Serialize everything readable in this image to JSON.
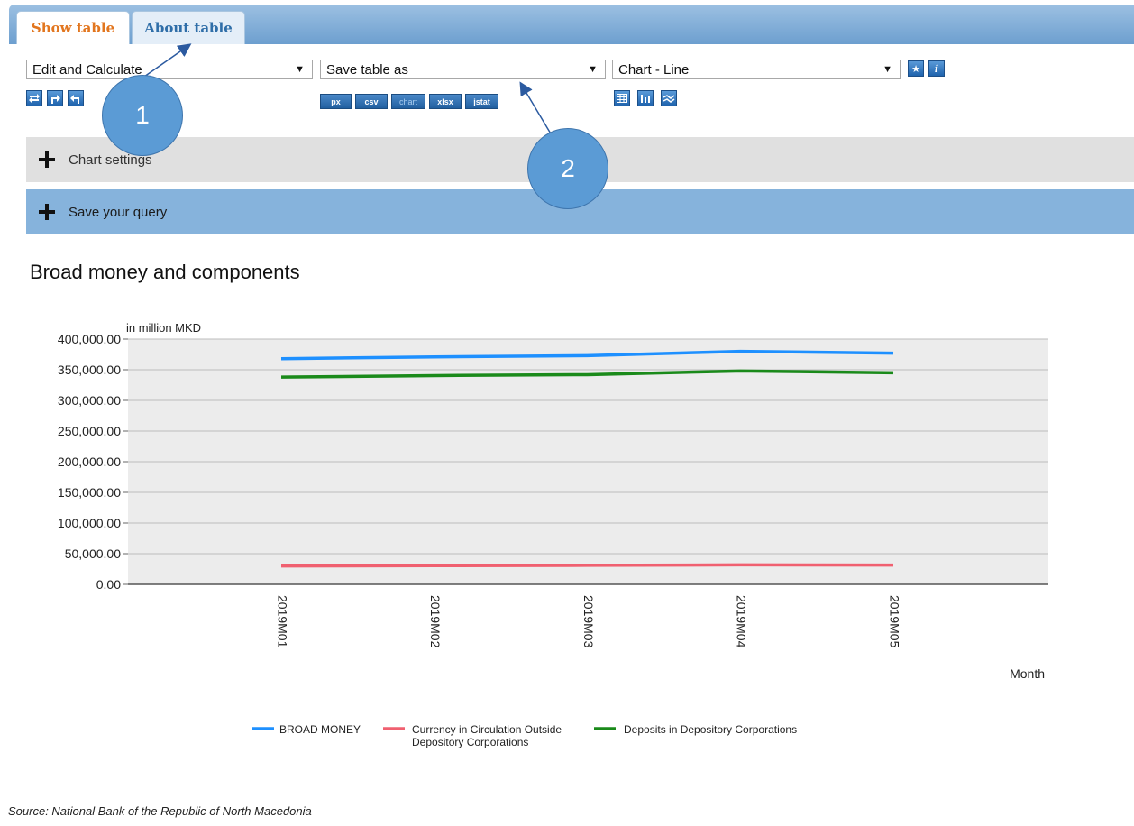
{
  "tabs": [
    {
      "label": "Show table",
      "active": true
    },
    {
      "label": "About table",
      "active": false
    }
  ],
  "toolbar": {
    "select1": "Edit and Calculate",
    "select2": "Save table as",
    "select3": "Chart - Line",
    "format_buttons": [
      "px",
      "csv",
      "chart",
      "xlsx",
      "jstat"
    ],
    "info_label": "i"
  },
  "accordions": {
    "chart_settings": "Chart settings",
    "save_query": "Save your query"
  },
  "annotations": [
    "1",
    "2"
  ],
  "source": "Source: National Bank of the Republic of North Macedonia",
  "colors": {
    "broad_money": "#1e90ff",
    "currency": "#f06070",
    "deposits": "#1a8a1a",
    "tab_active": "#e2761f",
    "accent": "#86b3dc"
  },
  "chart_data": {
    "type": "line",
    "title": "Broad money and components",
    "ylabel": "in million MKD",
    "xlabel": "Month",
    "ylim": [
      0,
      400000
    ],
    "yticks": [
      "0.00",
      "50,000.00",
      "100,000.00",
      "150,000.00",
      "200,000.00",
      "250,000.00",
      "300,000.00",
      "350,000.00",
      "400,000.00"
    ],
    "categories": [
      "2019M01",
      "2019M02",
      "2019M03",
      "2019M04",
      "2019M05"
    ],
    "legend_position": "bottom",
    "series": [
      {
        "name": "BROAD MONEY",
        "color": "#1e90ff",
        "values": [
          368000,
          371000,
          373000,
          380000,
          377000
        ]
      },
      {
        "name": "Currency in Circulation Outside Depository Corporations",
        "color": "#f06070",
        "values": [
          30000,
          30500,
          31000,
          31800,
          31500
        ]
      },
      {
        "name": "Deposits in Depository Corporations",
        "color": "#1a8a1a",
        "values": [
          338000,
          340500,
          342000,
          348000,
          345000
        ]
      }
    ]
  }
}
